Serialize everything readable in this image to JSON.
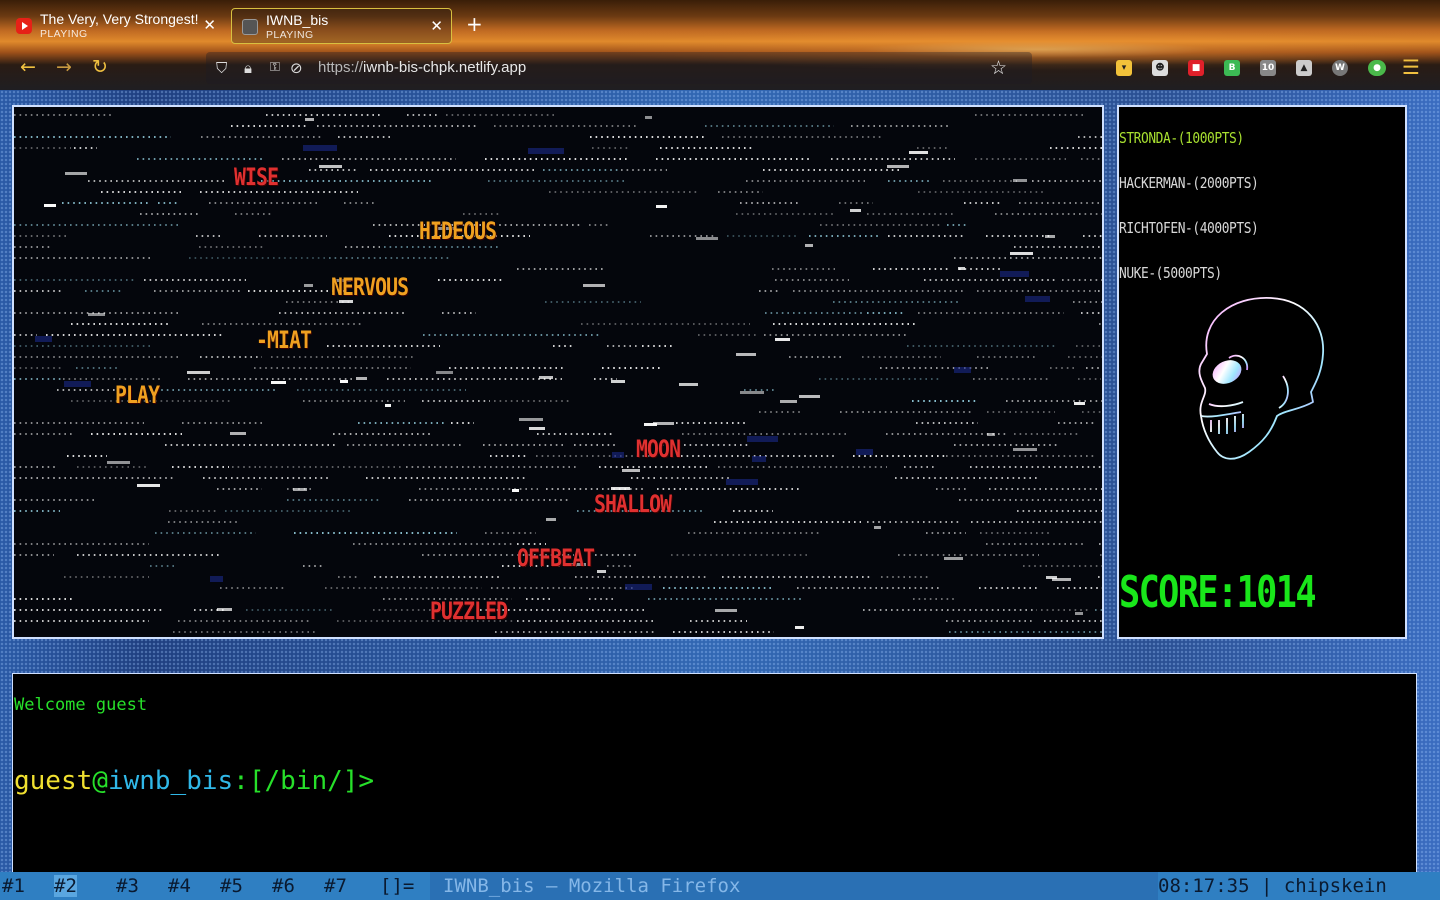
{
  "tabs": [
    {
      "title": "The Very, Very Strongest!",
      "status": "PLAYING",
      "icon": "youtube-icon"
    },
    {
      "title": "IWNB_bis",
      "status": "PLAYING",
      "icon": "game-icon"
    }
  ],
  "navbar": {
    "url_protocol": "https://",
    "url_host": "iwnb-bis-chpk.netlify.app"
  },
  "game": {
    "words": [
      {
        "text": "WISE",
        "color": "#e03030"
      },
      {
        "text": "HIDEOUS",
        "color": "#f0a020"
      },
      {
        "text": "NERVOUS",
        "color": "#f0a020"
      },
      {
        "text": "-MIAT",
        "color": "#f0a020"
      },
      {
        "text": "PLAY",
        "color": "#f0a020"
      },
      {
        "text": "MOON",
        "color": "#e03030"
      },
      {
        "text": "SHALLOW",
        "color": "#e03030"
      },
      {
        "text": "OFFBEAT",
        "color": "#e03030"
      },
      {
        "text": "PUZZLED",
        "color": "#e03030"
      }
    ]
  },
  "leaderboard": [
    "STRONDA-(1000PTS)",
    "HACKERMAN-(2000PTS)",
    "RICHTOFEN-(4000PTS)",
    "NUKE-(5000PTS)"
  ],
  "score_label": "SCORE:1014",
  "terminal": {
    "welcome": "Welcome guest",
    "prompt_user": "guest",
    "prompt_at": "@",
    "prompt_host": "iwnb_bis",
    "prompt_path": ":[/bin/]>"
  },
  "wm": {
    "workspaces": [
      "#1",
      "#2",
      "#3",
      "#4",
      "#5",
      "#6",
      "#7"
    ],
    "layout": "[]=",
    "window_title": "IWNB_bis — Mozilla Firefox",
    "status": "08:17:35 | chipskein"
  },
  "colors": {
    "accent_yellow": "#f0c040",
    "score_green": "#19e61a",
    "terminal_green": "#27e02a"
  }
}
